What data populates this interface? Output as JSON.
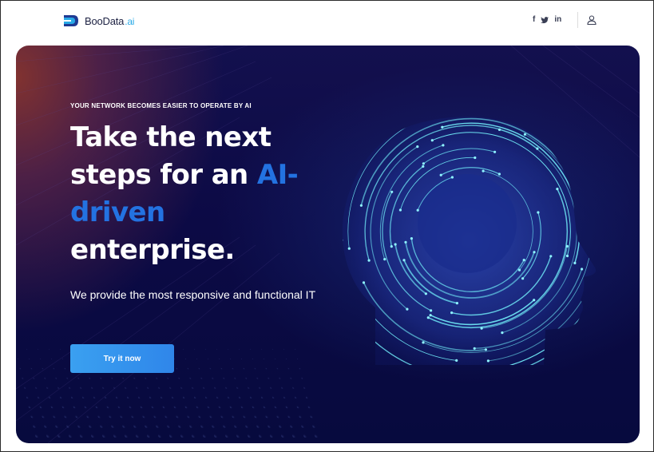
{
  "brand": {
    "name": "BooData",
    "suffix": ".ai"
  },
  "header": {
    "social": [
      {
        "label": "f",
        "icon": "facebook-icon"
      },
      {
        "label": "twitter",
        "icon": "twitter-icon"
      },
      {
        "label": "in",
        "icon": "linkedin-icon"
      }
    ],
    "user_icon": "user-icon"
  },
  "hero": {
    "kicker": "YOUR NETWORK BECOMES EASIER TO OPERATE BY AI",
    "headline_1": "Take the next steps for an ",
    "headline_accent": "AI-driven",
    "headline_2": " enterprise.",
    "subtext": "We provide the most responsive and functional IT",
    "cta_label": "Try it now",
    "image": "ai-head-illustration"
  },
  "colors": {
    "accent_blue": "#2372e1",
    "logo_blue": "#29a9e6",
    "hero_bg": "#0c0a45",
    "button": "#3aa0f0",
    "circuit": "#6ee6f4"
  }
}
